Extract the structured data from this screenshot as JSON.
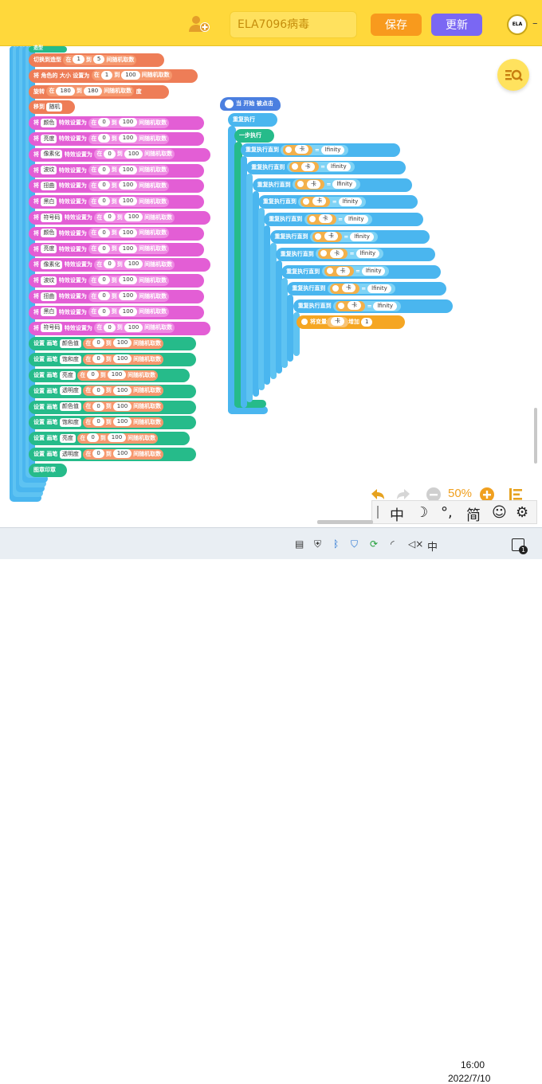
{
  "header": {
    "project_name": "ELA7096病毒",
    "save_label": "保存",
    "update_label": "更新",
    "logo_text": "ELA",
    "win_ctrl": "–"
  },
  "colors": {
    "header": "#ffd83b",
    "looks": "#e35ed5",
    "pen": "#26bb8a",
    "control": "#4ab6ef",
    "motion": "#ee7d57"
  },
  "left_script": {
    "top_label": "造型",
    "blocks": [
      {
        "kind": "switch",
        "text": "切换到造型",
        "pre": "在",
        "a": "1",
        "mid": "到",
        "b": "5",
        "post": "间随机取数",
        "color": "orange"
      },
      {
        "kind": "size",
        "text": "将 角色的 大小 设置为",
        "pre": "在",
        "a": "1",
        "mid": "到",
        "b": "100",
        "post": "间随机取数",
        "color": "orange"
      },
      {
        "kind": "rot",
        "text": "旋转",
        "pre": "在",
        "a": "180",
        "mid": "到",
        "b": "180",
        "post": "间随机取数",
        "suffix": "度",
        "color": "orange"
      },
      {
        "kind": "move",
        "text": "移到",
        "dd": "随机",
        "color": "orange"
      }
    ],
    "effects": [
      {
        "dd": "颜色",
        "a": "0",
        "b": "100"
      },
      {
        "dd": "亮度",
        "a": "0",
        "b": "100"
      },
      {
        "dd": "像素化",
        "a": "0",
        "b": "100"
      },
      {
        "dd": "波纹",
        "a": "0",
        "b": "100"
      },
      {
        "dd": "扭曲",
        "a": "0",
        "b": "100"
      },
      {
        "dd": "黑白",
        "a": "0",
        "b": "100"
      },
      {
        "dd": "符号码",
        "a": "0",
        "b": "100"
      },
      {
        "dd": "颜色",
        "a": "0",
        "b": "100"
      },
      {
        "dd": "亮度",
        "a": "0",
        "b": "100"
      },
      {
        "dd": "像素化",
        "a": "0",
        "b": "100"
      },
      {
        "dd": "波纹",
        "a": "0",
        "b": "100"
      },
      {
        "dd": "扭曲",
        "a": "0",
        "b": "100"
      },
      {
        "dd": "黑白",
        "a": "0",
        "b": "100"
      },
      {
        "dd": "符号码",
        "a": "0",
        "b": "100"
      }
    ],
    "effect_text": {
      "pre_label": "将",
      "post_label": "特效设置为",
      "in": "在",
      "to": "到",
      "rand": "间随机取数"
    },
    "pens": [
      {
        "dd": "颜色值",
        "a": "0",
        "b": "100"
      },
      {
        "dd": "饱和度",
        "a": "0",
        "b": "100"
      },
      {
        "dd": "亮度",
        "a": "0",
        "b": "100"
      },
      {
        "dd": "透明度",
        "a": "0",
        "b": "100"
      },
      {
        "dd": "颜色值",
        "a": "0",
        "b": "100"
      },
      {
        "dd": "饱和度",
        "a": "0",
        "b": "100"
      },
      {
        "dd": "亮度",
        "a": "0",
        "b": "100"
      },
      {
        "dd": "透明度",
        "a": "0",
        "b": "100"
      }
    ],
    "pen_text": {
      "label": "设置 画笔",
      "in": "在",
      "to": "到",
      "rand": "间随机取数"
    },
    "stamp": "图章印章"
  },
  "right_script": {
    "hat": "当 开始 被点击",
    "forever": "重复执行",
    "step": "一步执行",
    "repeat_until": "重复执行直到",
    "var": "卡",
    "op": "=",
    "value": "lfinity",
    "change_pre": "将变量",
    "change_mid": "增加",
    "change_val": "1"
  },
  "zoom": {
    "level": "50%"
  },
  "ime": {
    "items": [
      "中",
      "☽",
      "°,",
      "简",
      "☺",
      "⚙"
    ]
  },
  "taskbar": {
    "time": "16:00",
    "date": "2022/7/10",
    "ime_label": "中",
    "notif": "1"
  }
}
